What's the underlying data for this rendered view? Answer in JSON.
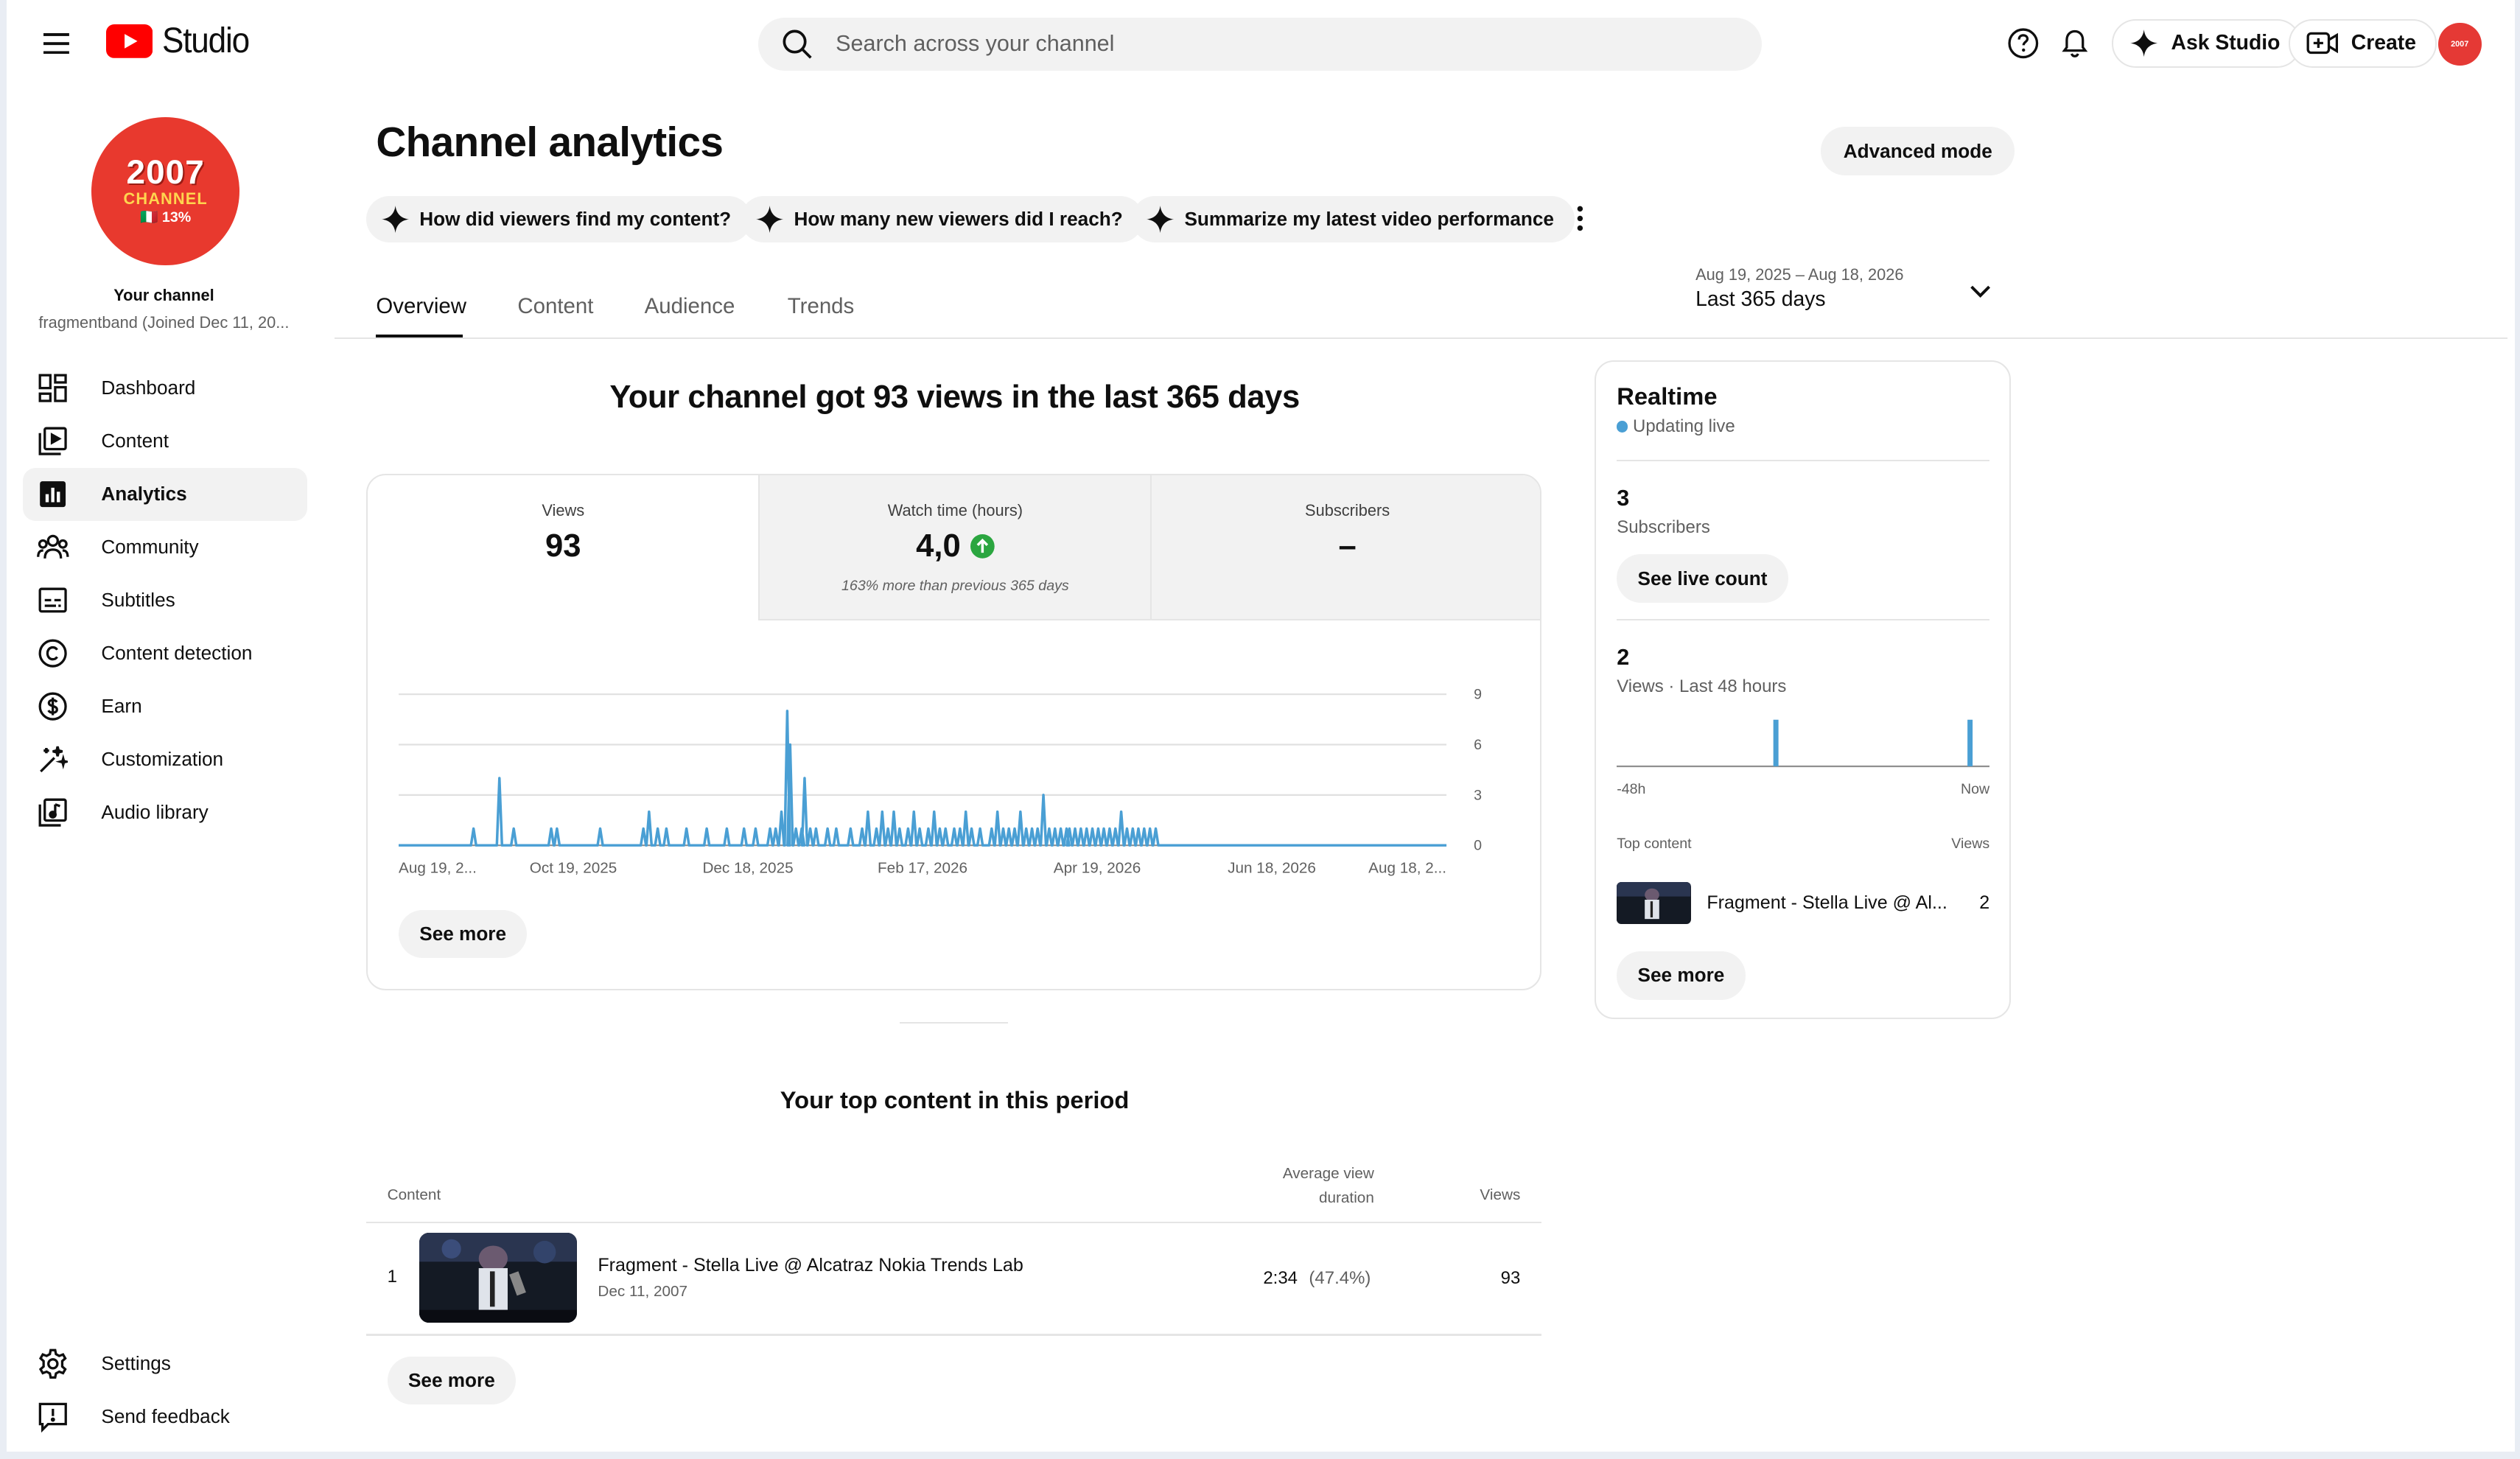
{
  "header": {
    "logo_text": "Studio",
    "search_placeholder": "Search across your channel",
    "ask_studio_label": "Ask Studio",
    "create_label": "Create",
    "avatar_text": "2007"
  },
  "sidebar": {
    "avatar": {
      "line1": "2007",
      "line2": "CHANNEL",
      "line3": "🇮🇹 13%"
    },
    "your_channel": "Your channel",
    "handle": "fragmentband (Joined Dec 11, 20...",
    "items": [
      {
        "label": "Dashboard",
        "icon": "dashboard-icon"
      },
      {
        "label": "Content",
        "icon": "content-icon"
      },
      {
        "label": "Analytics",
        "icon": "analytics-icon",
        "active": true
      },
      {
        "label": "Community",
        "icon": "community-icon"
      },
      {
        "label": "Subtitles",
        "icon": "subtitles-icon"
      },
      {
        "label": "Content detection",
        "icon": "copyright-icon"
      },
      {
        "label": "Earn",
        "icon": "dollar-icon"
      },
      {
        "label": "Customization",
        "icon": "magic-wand-icon"
      },
      {
        "label": "Audio library",
        "icon": "audio-library-icon"
      }
    ],
    "settings_label": "Settings",
    "feedback_label": "Send feedback"
  },
  "main": {
    "title": "Channel analytics",
    "advanced_mode": "Advanced mode",
    "chips": [
      "How did viewers find my content?",
      "How many new viewers did I reach?",
      "Summarize my latest video performance"
    ],
    "tabs": [
      "Overview",
      "Content",
      "Audience",
      "Trends"
    ],
    "date_range": {
      "range": "Aug 19, 2025 – Aug 18, 2026",
      "label": "Last 365 days"
    },
    "headline": "Your channel got 93 views in the last 365 days",
    "metrics": [
      {
        "label": "Views",
        "value": "93",
        "note": ""
      },
      {
        "label": "Watch time (hours)",
        "value": "4,0",
        "note": "163% more than previous 365 days"
      },
      {
        "label": "Subscribers",
        "value": "–",
        "note": ""
      }
    ],
    "see_more": "See more",
    "top_content": {
      "title": "Your top content in this period",
      "col_content": "Content",
      "col_avd_line1": "Average view",
      "col_avd_line2": "duration",
      "col_views": "Views",
      "rows": [
        {
          "rank": "1",
          "title": "Fragment - Stella Live @ Alcatraz Nokia Trends Lab",
          "date": "Dec 11, 2007",
          "duration": "2:34",
          "percent": "(47.4%)",
          "views": "93"
        }
      ],
      "see_more": "See more"
    }
  },
  "realtime": {
    "title": "Realtime",
    "live_label": "Updating live",
    "subscribers_value": "3",
    "subscribers_label": "Subscribers",
    "see_live_count": "See live count",
    "views_value": "2",
    "views_label": "Views · Last 48 hours",
    "axis_start": "-48h",
    "axis_end": "Now",
    "bars": [
      0,
      0,
      0,
      0,
      0,
      0,
      0,
      0,
      0,
      0,
      0,
      0,
      0,
      0,
      0,
      0,
      0,
      0,
      0,
      0,
      1,
      0,
      0,
      0,
      0,
      0,
      0,
      0,
      0,
      0,
      0,
      0,
      0,
      0,
      0,
      0,
      0,
      0,
      0,
      0,
      0,
      0,
      0,
      0,
      0,
      1,
      0,
      0
    ],
    "top_content_label": "Top content",
    "views_col_label": "Views",
    "top_item": {
      "title": "Fragment - Stella Live @ Al...",
      "views": "2"
    },
    "see_more": "See more"
  },
  "colors": {
    "accent_line": "#4a9fd4",
    "brand_red": "#ff0000",
    "up_green": "#2ba640"
  },
  "chart_data": {
    "type": "line",
    "x_tick_labels": [
      "Aug 19, 2...",
      "Oct 19, 2025",
      "Dec 18, 2025",
      "Feb 17, 2026",
      "Apr 19, 2026",
      "Jun 18, 2026",
      "Aug 18, 2..."
    ],
    "y_tick_labels": [
      "0",
      "3",
      "6",
      "9"
    ],
    "ylim": [
      0,
      9
    ],
    "grid": true,
    "x_unit": "day index (0–364) from Aug 19, 2025",
    "y_unit": "daily views",
    "spikes": [
      [
        26,
        1
      ],
      [
        35,
        4
      ],
      [
        40,
        1
      ],
      [
        53,
        1
      ],
      [
        55,
        1
      ],
      [
        70,
        1
      ],
      [
        85,
        1
      ],
      [
        87,
        2
      ],
      [
        90,
        1
      ],
      [
        93,
        1
      ],
      [
        100,
        1
      ],
      [
        107,
        1
      ],
      [
        114,
        1
      ],
      [
        120,
        1
      ],
      [
        124,
        1
      ],
      [
        129,
        1
      ],
      [
        131,
        1
      ],
      [
        133,
        2
      ],
      [
        135,
        8
      ],
      [
        136,
        6
      ],
      [
        138,
        1
      ],
      [
        140,
        1
      ],
      [
        141,
        4
      ],
      [
        143,
        1
      ],
      [
        145,
        1
      ],
      [
        149,
        1
      ],
      [
        152,
        1
      ],
      [
        157,
        1
      ],
      [
        161,
        1
      ],
      [
        163,
        2
      ],
      [
        166,
        1
      ],
      [
        168,
        2
      ],
      [
        170,
        1
      ],
      [
        172,
        2
      ],
      [
        174,
        1
      ],
      [
        177,
        1
      ],
      [
        179,
        2
      ],
      [
        181,
        1
      ],
      [
        184,
        1
      ],
      [
        186,
        2
      ],
      [
        188,
        1
      ],
      [
        190,
        1
      ],
      [
        193,
        1
      ],
      [
        195,
        1
      ],
      [
        197,
        2
      ],
      [
        199,
        1
      ],
      [
        202,
        1
      ],
      [
        206,
        1
      ],
      [
        208,
        2
      ],
      [
        210,
        1
      ],
      [
        212,
        1
      ],
      [
        214,
        1
      ],
      [
        216,
        2
      ],
      [
        218,
        1
      ],
      [
        220,
        1
      ],
      [
        222,
        1
      ],
      [
        224,
        3
      ],
      [
        226,
        1
      ],
      [
        228,
        1
      ],
      [
        230,
        1
      ],
      [
        232,
        1
      ],
      [
        233,
        1
      ],
      [
        235,
        1
      ],
      [
        237,
        1
      ],
      [
        239,
        1
      ],
      [
        241,
        1
      ],
      [
        243,
        1
      ],
      [
        245,
        1
      ],
      [
        247,
        1
      ],
      [
        249,
        1
      ],
      [
        251,
        2
      ],
      [
        253,
        1
      ],
      [
        255,
        1
      ],
      [
        257,
        1
      ],
      [
        259,
        1
      ],
      [
        261,
        1
      ],
      [
        263,
        1
      ]
    ],
    "x_domain": [
      0,
      364
    ]
  }
}
